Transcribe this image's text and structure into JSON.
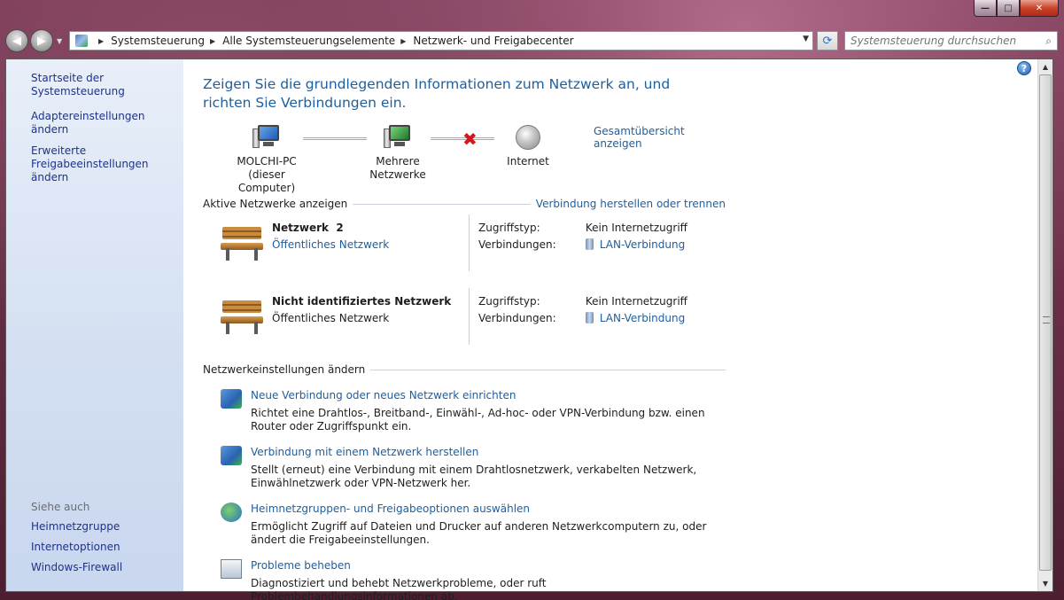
{
  "window": {
    "caption_buttons": {
      "minimize": "—",
      "maximize": "□",
      "close": "✕"
    }
  },
  "navbar": {
    "breadcrumbs": [
      "Systemsteuerung",
      "Alle Systemsteuerungselemente",
      "Netzwerk- und Freigabecenter"
    ],
    "search_placeholder": "Systemsteuerung durchsuchen"
  },
  "sidebar": {
    "tasks": [
      {
        "label": "Startseite der Systemsteuerung"
      },
      {
        "label": "Adaptereinstellungen ändern"
      },
      {
        "label": "Erweiterte Freigabeeinstellungen ändern"
      }
    ],
    "see_also_title": "Siehe auch",
    "see_also": [
      {
        "label": "Heimnetzgruppe"
      },
      {
        "label": "Internetoptionen"
      },
      {
        "label": "Windows-Firewall"
      }
    ]
  },
  "main": {
    "heading": "Zeigen Sie die grundlegenden Informationen zum Netzwerk an, und richten Sie Verbindungen ein.",
    "map": {
      "computer_name": "MOLCHI-PC",
      "computer_sub": "(dieser Computer)",
      "networks_label": "Mehrere Netzwerke",
      "internet_label": "Internet",
      "overview_link": "Gesamtübersicht anzeigen"
    },
    "active_networks": {
      "title": "Aktive Netzwerke anzeigen",
      "link": "Verbindung herstellen oder trennen",
      "items": [
        {
          "name": "Netzwerk  2",
          "category": "Öffentliches Netzwerk",
          "access_key": "Zugriffstyp:",
          "access_value": "Kein Internetzugriff",
          "conn_key": "Verbindungen:",
          "conn_value": "LAN-Verbindung"
        },
        {
          "name": "Nicht identifiziertes Netzwerk",
          "category": "Öffentliches Netzwerk",
          "access_key": "Zugriffstyp:",
          "access_value": "Kein Internetzugriff",
          "conn_key": "Verbindungen:",
          "conn_value": "LAN-Verbindung"
        }
      ]
    },
    "change_settings": {
      "title": "Netzwerkeinstellungen ändern",
      "tasks": [
        {
          "title": "Neue Verbindung oder neues Netzwerk einrichten",
          "desc": "Richtet eine Drahtlos-, Breitband-, Einwähl-, Ad-hoc- oder VPN-Verbindung bzw. einen Router oder Zugriffspunkt ein."
        },
        {
          "title": "Verbindung mit einem Netzwerk herstellen",
          "desc": "Stellt (erneut) eine Verbindung mit einem Drahtlosnetzwerk, verkabelten Netzwerk, Einwählnetzwerk oder VPN-Netzwerk her."
        },
        {
          "title": "Heimnetzgruppen- und Freigabeoptionen auswählen",
          "desc": "Ermöglicht Zugriff auf Dateien und Drucker auf anderen Netzwerkcomputern zu, oder ändert die Freigabeeinstellungen."
        },
        {
          "title": "Probleme beheben",
          "desc": "Diagnostiziert und behebt Netzwerkprobleme, oder ruft Problembehandlungsinformationen ab."
        }
      ]
    }
  },
  "colors": {
    "link": "#1e5fa0",
    "sidebar_link": "#1e3287",
    "heading": "#1e5fa0",
    "error_x": "#d2161e"
  },
  "icons": {
    "help": "?",
    "search": "⌕",
    "refresh": "⟳",
    "back": "◀",
    "forward": "▶",
    "error": "✖"
  }
}
